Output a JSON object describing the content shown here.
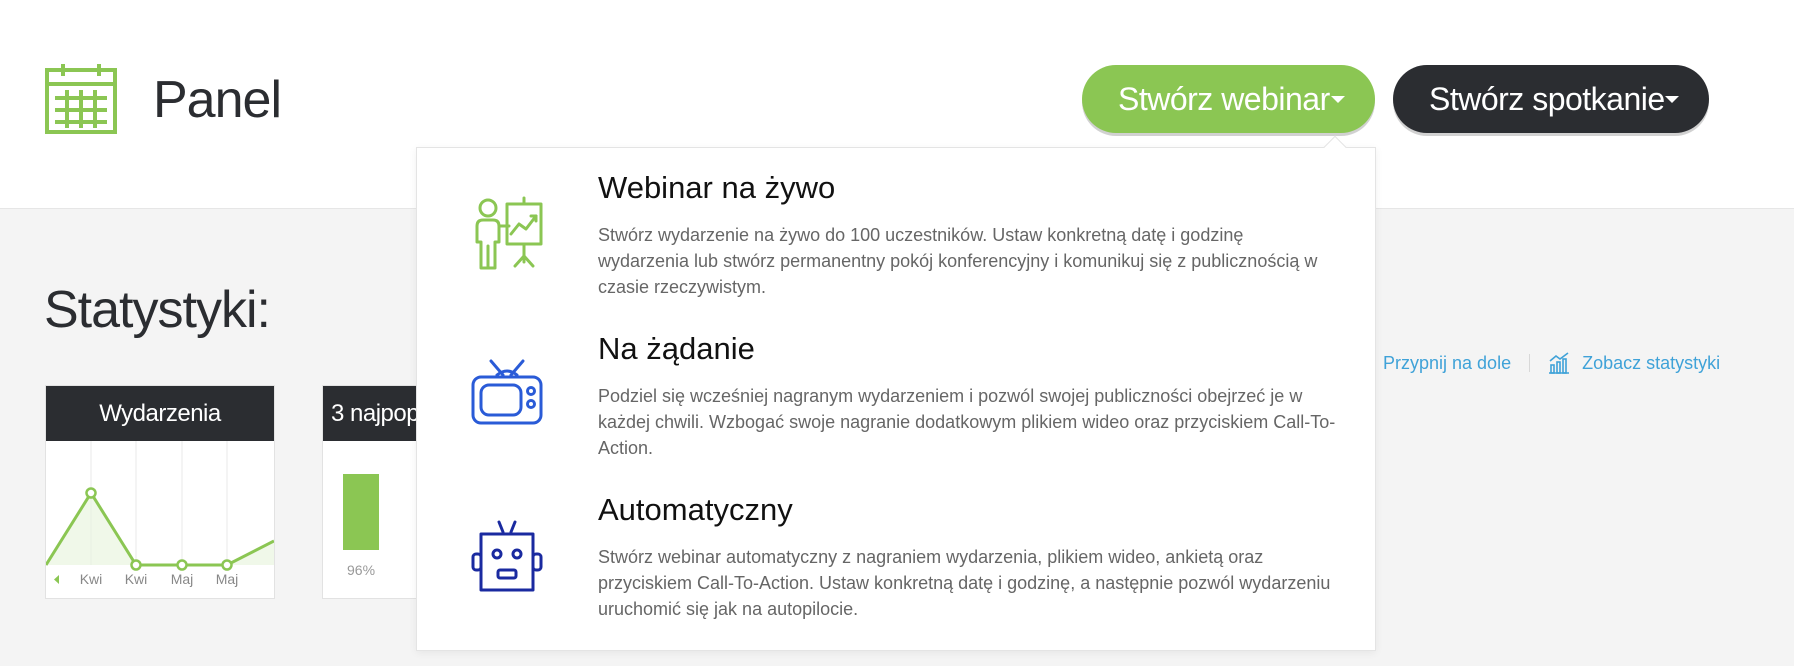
{
  "header": {
    "title": "Panel",
    "buttons": {
      "create_webinar": "Stwórz webinar",
      "create_meeting": "Stwórz spotkanie"
    }
  },
  "colors": {
    "accent_green": "#8bc653",
    "dark": "#2b2d31",
    "link_blue": "#3fa2d8",
    "icon_blue": "#2a5bd7",
    "icon_navy": "#1a2aa0"
  },
  "stats": {
    "title": "Statystyki:",
    "links": {
      "pin": "Przypnij na dole",
      "view_stats": "Zobacz statystyki"
    },
    "cards": [
      {
        "title": "Wydarzenia"
      },
      {
        "title": "3 najpop"
      }
    ]
  },
  "chart_data": [
    {
      "type": "line",
      "title": "Wydarzenia",
      "categories": [
        "",
        "Kwi",
        "Kwi",
        "Maj",
        "Maj",
        ""
      ],
      "values": [
        0,
        3,
        0,
        0,
        0,
        1
      ]
    },
    {
      "type": "bar",
      "title": "3 najpop",
      "categories": [
        ""
      ],
      "values": [
        96
      ],
      "data_labels": [
        "96%"
      ]
    }
  ],
  "dropdown": {
    "items": [
      {
        "title": "Webinar na żywo",
        "description": "Stwórz wydarzenie na żywo do 100 uczestników. Ustaw konkretną datę i godzinę wydarzenia lub stwórz permanentny pokój konferencyjny i komunikuj się z publicznością w czasie rzeczywistym.",
        "icon": "presenter-icon"
      },
      {
        "title": "Na żądanie",
        "description": "Podziel się wcześniej nagranym wydarzeniem i pozwól swojej publiczności obejrzeć je w każdej chwili. Wzbogać swoje nagranie dodatkowym plikiem wideo oraz przyciskiem Call-To-Action.",
        "icon": "tv-icon"
      },
      {
        "title": "Automatyczny",
        "description": "Stwórz webinar automatyczny z nagraniem wydarzenia, plikiem wideo, ankietą oraz przyciskiem Call-To-Action. Ustaw konkretną datę i godzinę, a następnie pozwól wydarzeniu uruchomić się jak na autopilocie.",
        "icon": "robot-icon"
      }
    ]
  }
}
